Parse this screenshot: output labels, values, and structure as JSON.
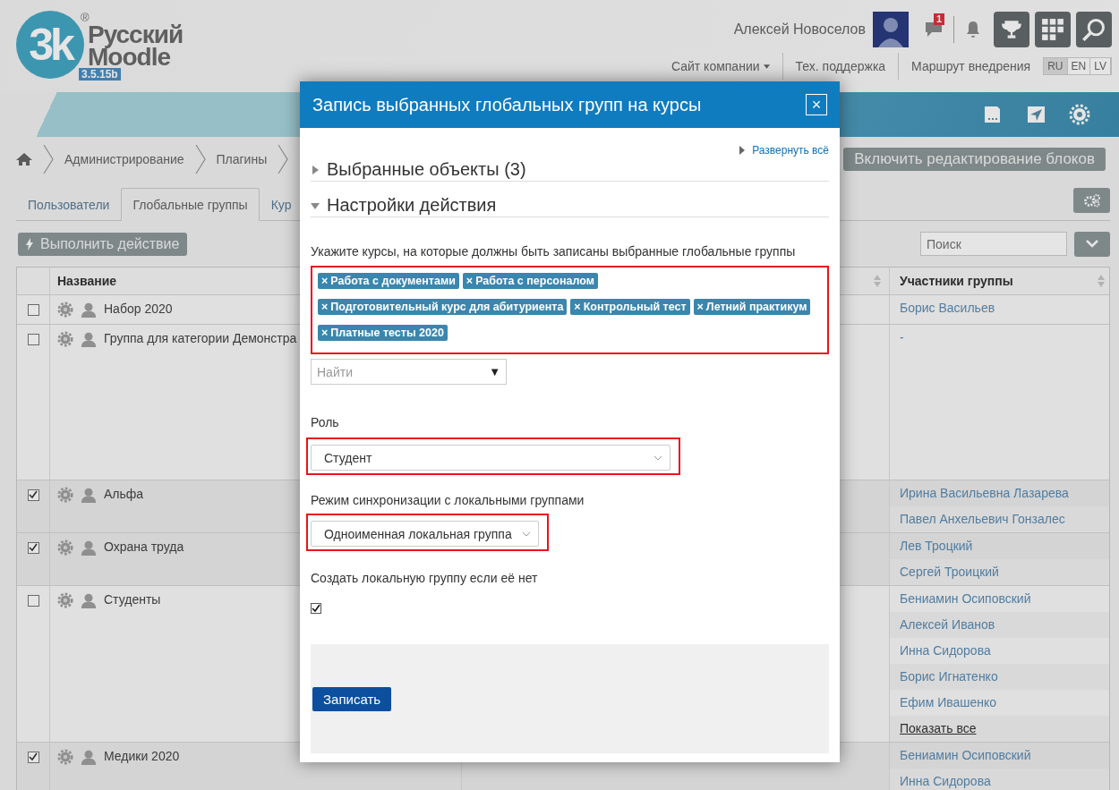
{
  "header": {
    "logo": {
      "mark": "3k",
      "registered": "®",
      "lines": [
        "Русский",
        "Moodle"
      ],
      "version": "3.5.15b"
    },
    "user_name": "Алексей Новоселов",
    "message_count": "1",
    "nav": [
      {
        "label": "Сайт компании",
        "dropdown": true
      },
      {
        "label": "Тех. поддержка",
        "dropdown": false
      },
      {
        "label": "Маршрут внедрения",
        "dropdown": false
      }
    ],
    "languages": [
      {
        "label": "RU",
        "selected": true
      },
      {
        "label": "EN",
        "selected": false
      },
      {
        "label": "LV",
        "selected": false
      }
    ]
  },
  "breadcrumbs": [
    "Администрирование",
    "Плагины"
  ],
  "edit_blocks_button": "Включить редактирование блоков",
  "tabs": [
    {
      "label": "Пользователи",
      "selected": false
    },
    {
      "label": "Глобальные группы",
      "selected": true
    },
    {
      "label": "Кур",
      "selected": false
    }
  ],
  "action_button": "Выполнить действие",
  "search": {
    "placeholder": "Поиск"
  },
  "table": {
    "columns": [
      "Название",
      "Участники группы"
    ],
    "rows": [
      {
        "name": "Набор 2020",
        "checked": false,
        "members": [
          "Борис Васильев"
        ]
      },
      {
        "name": "Группа для категории Демонстра",
        "checked": false,
        "members": [
          "-"
        ]
      },
      {
        "name": "Альфа",
        "checked": true,
        "members": [
          "Ирина Васильевна Лазарева",
          "Павел Анхельевич Гонзалес"
        ]
      },
      {
        "name": "Охрана труда",
        "checked": true,
        "members": [
          "Лев Троцкий",
          "Сергей Троицкий"
        ]
      },
      {
        "name": "Студенты",
        "checked": false,
        "members": [
          "Бениамин Осиповский",
          "Алексей Иванов",
          "Инна Сидорова",
          "Борис Игнатенко",
          "Ефим Ивашенко"
        ],
        "show_all": "Показать все"
      },
      {
        "name": "Медики 2020",
        "checked": true,
        "members": [
          "Бениамин Осиповский",
          "Инна Сидорова"
        ]
      }
    ]
  },
  "modal": {
    "title": "Запись выбранных глобальных групп на курсы",
    "close": "×",
    "expand_all": "Развернуть всё",
    "sections": [
      {
        "title": "Выбранные объекты (3)",
        "expanded": false
      },
      {
        "title": "Настройки действия",
        "expanded": true
      }
    ],
    "courses_label": "Укажите курсы, на которые должны быть записаны выбранные глобальные группы",
    "courses": {
      "highlighted": true,
      "tags": [
        {
          "remove": "×",
          "label": "Работа с документами"
        },
        {
          "remove": "×",
          "label": "Работа с персоналом"
        },
        {
          "remove": "×",
          "label": "Подготовительный курс для абитуриента"
        },
        {
          "remove": "×",
          "label": "Контрольный тест"
        },
        {
          "remove": "×",
          "label": "Летний практикум"
        },
        {
          "remove": "×",
          "label": "Платные тесты 2020"
        }
      ]
    },
    "find": {
      "placeholder": "Найти",
      "arrow": "▼"
    },
    "role": {
      "label": "Роль",
      "value": "Студент",
      "highlighted": true
    },
    "sync": {
      "label": "Режим синхронизации с локальными группами",
      "value": "Одноименная локальная группа",
      "highlighted": true
    },
    "create_local": {
      "label": "Создать локальную группу если её нет",
      "checked": true
    },
    "submit": "Записать"
  }
}
